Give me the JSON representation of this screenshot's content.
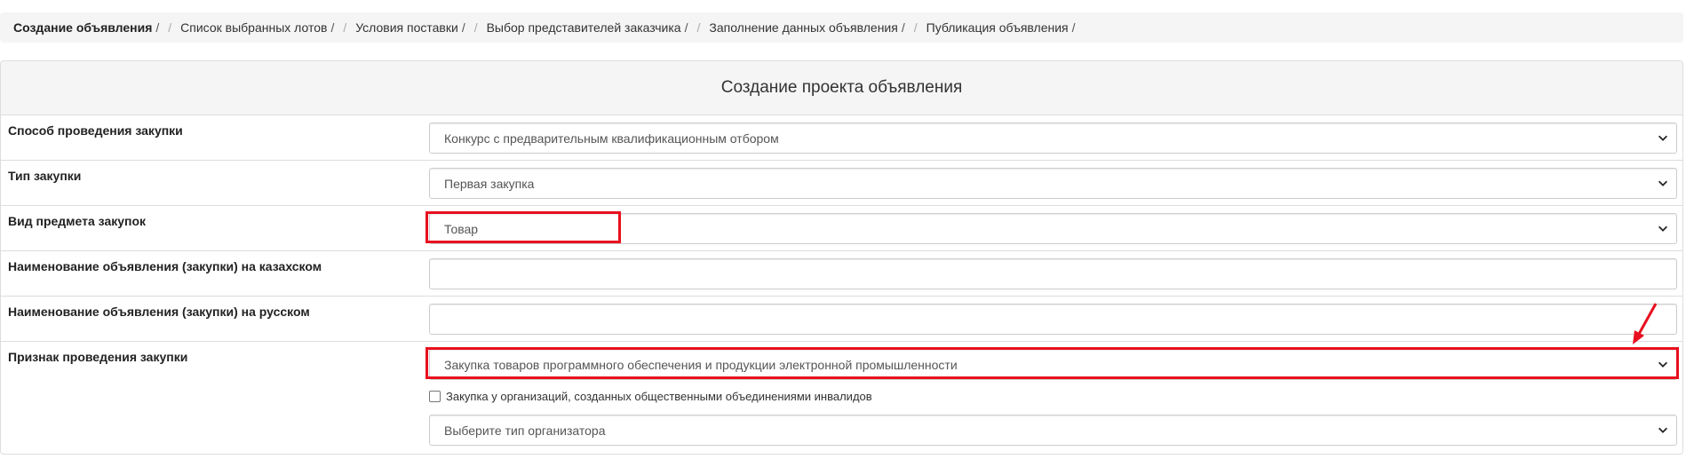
{
  "breadcrumb": {
    "items": [
      "Создание объявления",
      "Список выбранных лотов",
      "Условия поставки",
      "Выбор представителей заказчика",
      "Заполнение данных объявления",
      "Публикация объявления"
    ],
    "separator": "/"
  },
  "panel": {
    "title": "Создание проекта объявления"
  },
  "form": {
    "method": {
      "label": "Способ проведения закупки",
      "value": "Конкурс с предварительным квалификационным отбором"
    },
    "type": {
      "label": "Тип закупки",
      "value": "Первая закупка"
    },
    "subject": {
      "label": "Вид предмета закупок",
      "value": "Товар"
    },
    "name_kz": {
      "label": "Наименование объявления (закупки) на казахском",
      "value": ""
    },
    "name_ru": {
      "label": "Наименование объявления (закупки) на русском",
      "value": ""
    },
    "sign": {
      "label": "Признак проведения закупки",
      "value": "Закупка товаров программного обеспечения и продукции электронной промышленности",
      "checkbox_label": "Закупка у организаций, созданных общественными объединениями инвалидов",
      "checkbox_checked": false,
      "organizer_placeholder": "Выберите тип организатора"
    }
  },
  "colors": {
    "highlight": "#e8101e",
    "breadcrumb_bg": "#f5f5f5",
    "border": "#dddddd"
  },
  "icons": {
    "select_arrow": "chevron-down-icon",
    "annotation": "red-arrow-icon"
  }
}
